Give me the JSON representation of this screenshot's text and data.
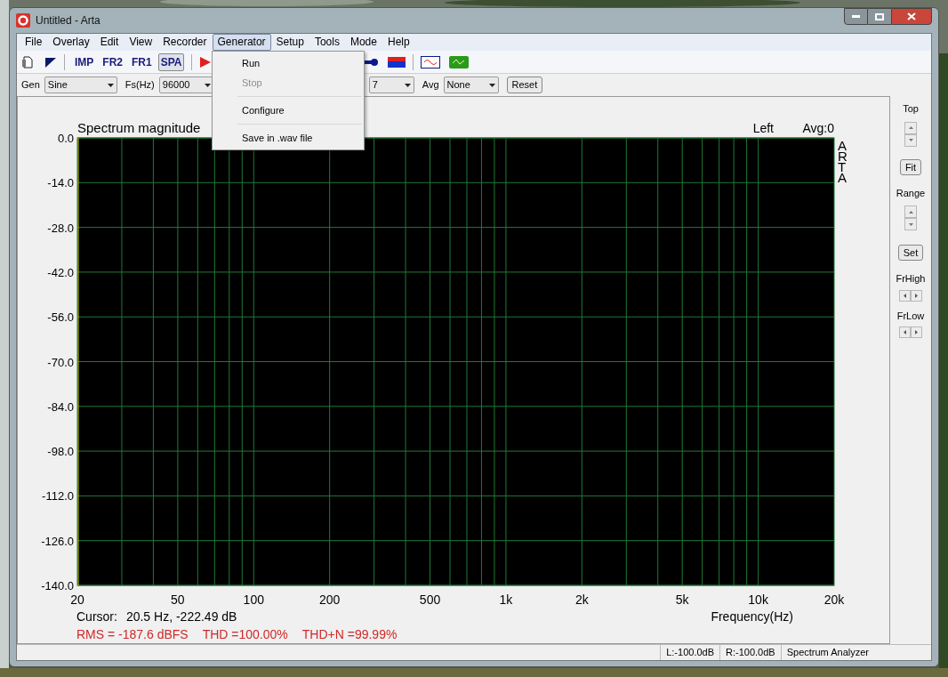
{
  "window": {
    "title": "Untitled - Arta"
  },
  "menu": [
    {
      "label": "File",
      "selected": false
    },
    {
      "label": "Overlay",
      "selected": false
    },
    {
      "label": "Edit",
      "selected": false
    },
    {
      "label": "View",
      "selected": false
    },
    {
      "label": "Recorder",
      "selected": false
    },
    {
      "label": "Generator",
      "selected": true
    },
    {
      "label": "Setup",
      "selected": false
    },
    {
      "label": "Tools",
      "selected": false
    },
    {
      "label": "Mode",
      "selected": false
    },
    {
      "label": "Help",
      "selected": false
    }
  ],
  "dropdown": {
    "items": [
      {
        "kind": "item",
        "label": "Run",
        "disabled": false
      },
      {
        "kind": "item",
        "label": "Stop",
        "disabled": true
      },
      {
        "kind": "separator"
      },
      {
        "kind": "item",
        "label": "Configure",
        "disabled": false
      },
      {
        "kind": "separator"
      },
      {
        "kind": "item",
        "label": "Save in .wav file",
        "disabled": false
      }
    ]
  },
  "toolbar": {
    "mode_buttons": [
      {
        "label": "IMP",
        "selected": false
      },
      {
        "label": "FR2",
        "selected": false
      },
      {
        "label": "FR1",
        "selected": false
      },
      {
        "label": "SPA",
        "selected": true
      }
    ]
  },
  "controls": {
    "gen_label": "Gen",
    "gen_value": "Sine",
    "fs_label": "Fs(Hz)",
    "fs_value": "96000",
    "partial_value": "7",
    "avg_label": "Avg",
    "avg_value": "None",
    "reset_button": "Reset"
  },
  "chart": {
    "title": "Spectrum magnitude",
    "channel": "Left",
    "avg": "Avg:0",
    "side_label": "ARTA",
    "cursor_label": "Cursor:",
    "cursor_value": "20.5 Hz, -222.49 dB",
    "rms": "RMS = -187.6 dBFS",
    "thd": "THD =100.00%",
    "thdn": "THD+N =99.99%",
    "x_axis_title": "Frequency(Hz)",
    "x_axis_labels": [
      "20",
      "50",
      "100",
      "200",
      "500",
      "1k",
      "2k",
      "5k",
      "10k",
      "20k"
    ],
    "y_axis_labels": [
      "0.0",
      "-14.0",
      "-28.0",
      "-42.0",
      "-56.0",
      "-70.0",
      "-84.0",
      "-98.0",
      "-112.0",
      "-126.0",
      "-140.0"
    ]
  },
  "side_panel": {
    "top_label": "Top",
    "fit_button": "Fit",
    "range_label": "Range",
    "set_button": "Set",
    "frhigh_label": "FrHigh",
    "frlow_label": "FrLow"
  },
  "status_bar": {
    "left_level": "L:-100.0dB",
    "right_level": "R:-100.0dB",
    "mode": "Spectrum Analyzer"
  }
}
